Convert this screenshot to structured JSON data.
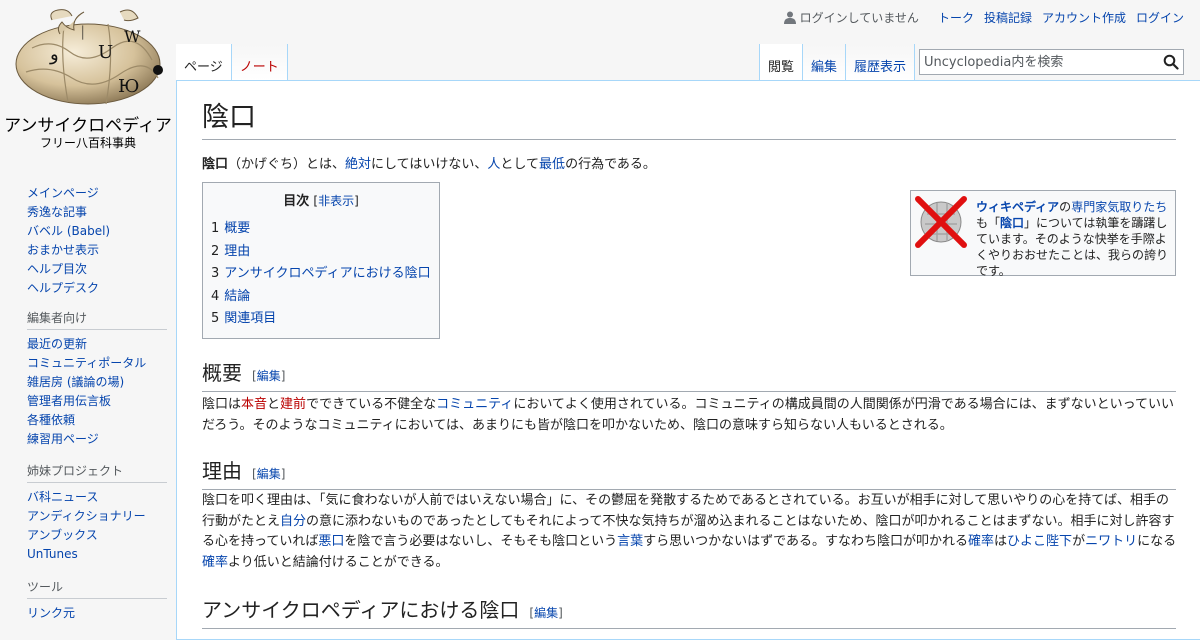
{
  "personal": {
    "anon": "ログインしていません",
    "talk": "トーク",
    "contribs": "投稿記録",
    "create": "アカウント作成",
    "login": "ログイン"
  },
  "logo": {
    "name": "アンサイクロペディア",
    "tagline": "フリー八百科事典",
    "glyphs": [
      "W",
      "ᛁ",
      "U",
      "Ю",
      "و"
    ]
  },
  "sidebar": {
    "navigation": [
      "メインページ",
      "秀逸な記事",
      "バベル (Babel)",
      "おまかせ表示",
      "ヘルプ目次",
      "ヘルプデスク"
    ],
    "edit_heading": "編集者向け",
    "edit": [
      "最近の更新",
      "コミュニティポータル",
      "雑居房 (議論の場)",
      "管理者用伝言板",
      "各種依頼",
      "練習用ページ"
    ],
    "sister_heading": "姉妹プロジェクト",
    "sister": [
      "バ科ニュース",
      "アンディクショナリー",
      "アンブックス",
      "UnTunes"
    ],
    "tools_heading": "ツール",
    "tools": [
      "リンク元"
    ]
  },
  "tabs": {
    "page": "ページ",
    "note": "ノート",
    "read": "閲覧",
    "edit": "編集",
    "history": "履歴表示"
  },
  "search": {
    "placeholder": "Uncyclopedia内を検索"
  },
  "article": {
    "title": "陰口",
    "intro": {
      "term": "陰口",
      "t1": "（かげぐち）とは、",
      "l1": "絶対",
      "t2": "にしてはいけない、",
      "l2": "人",
      "t3": "として",
      "l3": "最低",
      "t4": "の行為である。"
    },
    "toc": {
      "title": "目次",
      "toggle": "非表示",
      "items": [
        {
          "num": "1",
          "label": "概要"
        },
        {
          "num": "2",
          "label": "理由"
        },
        {
          "num": "3",
          "label": "アンサイクロペディアにおける陰口"
        },
        {
          "num": "4",
          "label": "結論"
        },
        {
          "num": "5",
          "label": "関連項目"
        }
      ]
    },
    "ambox": {
      "link1": "ウィキペディア",
      "t1": "の",
      "link2": "専門家気取りたち",
      "t2": "も「",
      "link3": "陰口",
      "t3": "」については執筆を躊躇しています。そのような快挙を手際よくやりおおせたことは、我らの誇りです。"
    },
    "edit_label": "編集",
    "sections": [
      {
        "heading": "概要",
        "p": {
          "t1": "陰口は",
          "r1": "本音",
          "t2": "と",
          "r2": "建前",
          "t3": "でできている不健全な",
          "l1": "コミュニティ",
          "t4": "においてよく使用されている。コミュニティの構成員間の人間関係が円滑である場合には、まずないといっていいだろう。そのようなコミュニティにおいては、あまりにも皆が陰口を叩かないため、陰口の意味すら知らない人もいるとされる。"
        }
      },
      {
        "heading": "理由",
        "p": {
          "t1": "陰口を叩く理由は、「気に食わないが人前ではいえない場合」に、その鬱屈を発散するためであるとされている。お互いが相手に対して思いやりの心を持てば、相手の行動がたとえ",
          "l1": "自分",
          "t2": "の意に添わないものであったとしてもそれによって不快な気持ちが溜め込まれることはないため、陰口が叩かれることはまずない。相手に対し許容する心を持っていれば",
          "l2": "悪口",
          "t3": "を陰で言う必要はないし、そもそも陰口という",
          "l3": "言葉",
          "t4": "すら思いつかないはずである。すなわち陰口が叩かれる",
          "l4": "確率",
          "t5": "は",
          "l5": "ひよこ陛下",
          "t6": "が",
          "l6": "ニワトリ",
          "t7": "になる",
          "l7": "確率",
          "t8": "より低いと結論付けることができる。"
        }
      },
      {
        "heading": "アンサイクロペディアにおける陰口"
      }
    ]
  },
  "colors": {
    "link": "#0645ad",
    "redlink": "#ba0000",
    "border": "#a7d7f9"
  }
}
